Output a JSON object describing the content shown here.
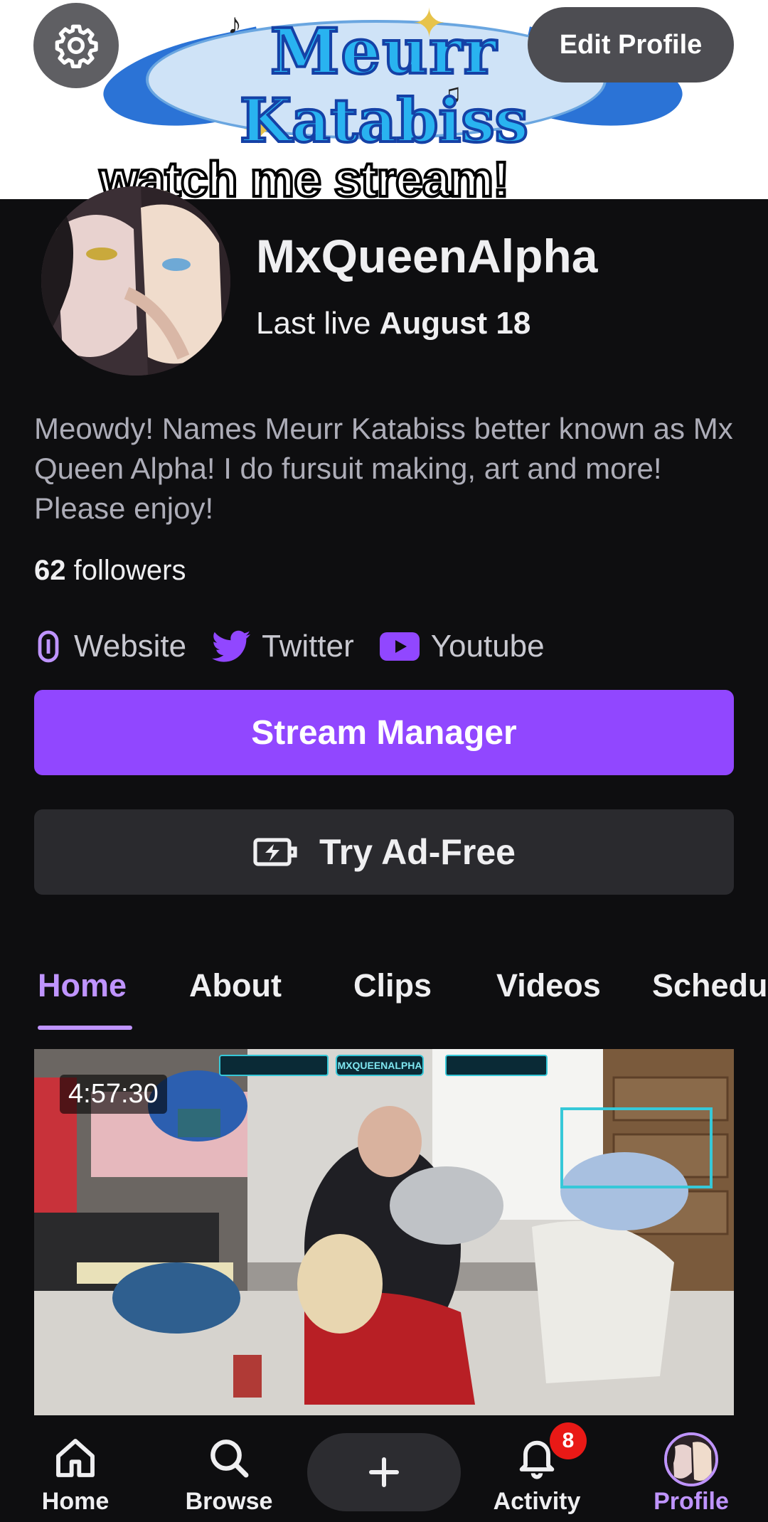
{
  "banner": {
    "logo_line1": "Meurr",
    "logo_line2": "Katabiss",
    "caption": "watch me stream!"
  },
  "header": {
    "edit_profile_label": "Edit Profile"
  },
  "profile": {
    "channel_name": "MxQueenAlpha",
    "last_live_prefix": "Last live",
    "last_live_date": "August 18",
    "bio": "Meowdy! Names Meurr Katabiss better known as Mx Queen Alpha! I do fursuit making, art and more! Please enjoy!",
    "followers_count": "62",
    "followers_label": "followers"
  },
  "links": [
    {
      "label": "Website",
      "icon": "link-icon"
    },
    {
      "label": "Twitter",
      "icon": "twitter-icon"
    },
    {
      "label": "Youtube",
      "icon": "youtube-icon"
    }
  ],
  "actions": {
    "stream_manager_label": "Stream Manager",
    "ad_free_label": "Try Ad-Free"
  },
  "tabs": [
    {
      "label": "Home",
      "active": true
    },
    {
      "label": "About",
      "active": false
    },
    {
      "label": "Clips",
      "active": false
    },
    {
      "label": "Videos",
      "active": false
    },
    {
      "label": "Schedu",
      "active": false
    }
  ],
  "video": {
    "duration": "4:57:30",
    "overlay_title": "MXQUEENALPHA"
  },
  "bottom_nav": {
    "home": "Home",
    "browse": "Browse",
    "activity": "Activity",
    "activity_badge": "8",
    "profile": "Profile"
  },
  "colors": {
    "accent": "#9147ff",
    "accent_light": "#bf94ff",
    "background": "#0e0e10",
    "badge": "#e91916"
  }
}
